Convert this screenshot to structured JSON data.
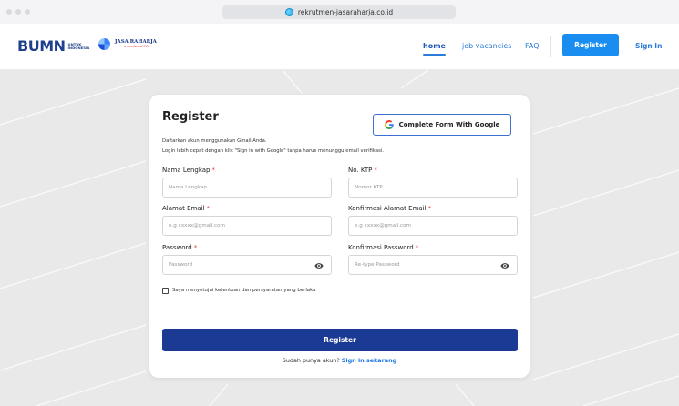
{
  "browser": {
    "url": "rekrutmen-jasaraharja.co.id"
  },
  "brand": {
    "bumn_mark": "BUMN",
    "bumn_sub": "UNTUK INDONESIA",
    "jr_name": "JASA RAHARJA",
    "jr_tag": "a member of IFG"
  },
  "nav": {
    "home": "home",
    "jobs": "job vacancies",
    "faq": "FAQ",
    "register": "Register",
    "signin": "Sign In"
  },
  "form": {
    "title": "Register",
    "google_button": "Complete Form With Google",
    "intro_line1": "Daftarkan akun menggunakan Gmail Anda.",
    "intro_line2": "Login lebih cepat dengan klik \"Sign in with Google\" tanpa harus menunggu email verifikasi.",
    "fields": {
      "full_name": {
        "label": "Nama Lengkap",
        "placeholder": "Nama Lengkap"
      },
      "ktp": {
        "label": "No. KTP",
        "placeholder": "Nomor KTP"
      },
      "email": {
        "label": "Alamat Email",
        "placeholder": "e.g xxxxx@gmail.com"
      },
      "email_confirm": {
        "label": "Konfirmasi Alamat Email",
        "placeholder": "e.g xxxxx@gmail.com"
      },
      "password": {
        "label": "Password",
        "placeholder": "Password"
      },
      "password_confirm": {
        "label": "Konfirmasi Password",
        "placeholder": "Re-type Password"
      }
    },
    "required_mark": "*",
    "agree_text": "Saya menyetujui ketentuan dan persyaratan yang berlaku",
    "submit": "Register",
    "have_account": "Sudah punya akun?",
    "signin_link": "Sign in sekarang"
  },
  "colors": {
    "primary": "#1b3a94",
    "accent": "#1a8ef0",
    "required": "#e53935"
  }
}
